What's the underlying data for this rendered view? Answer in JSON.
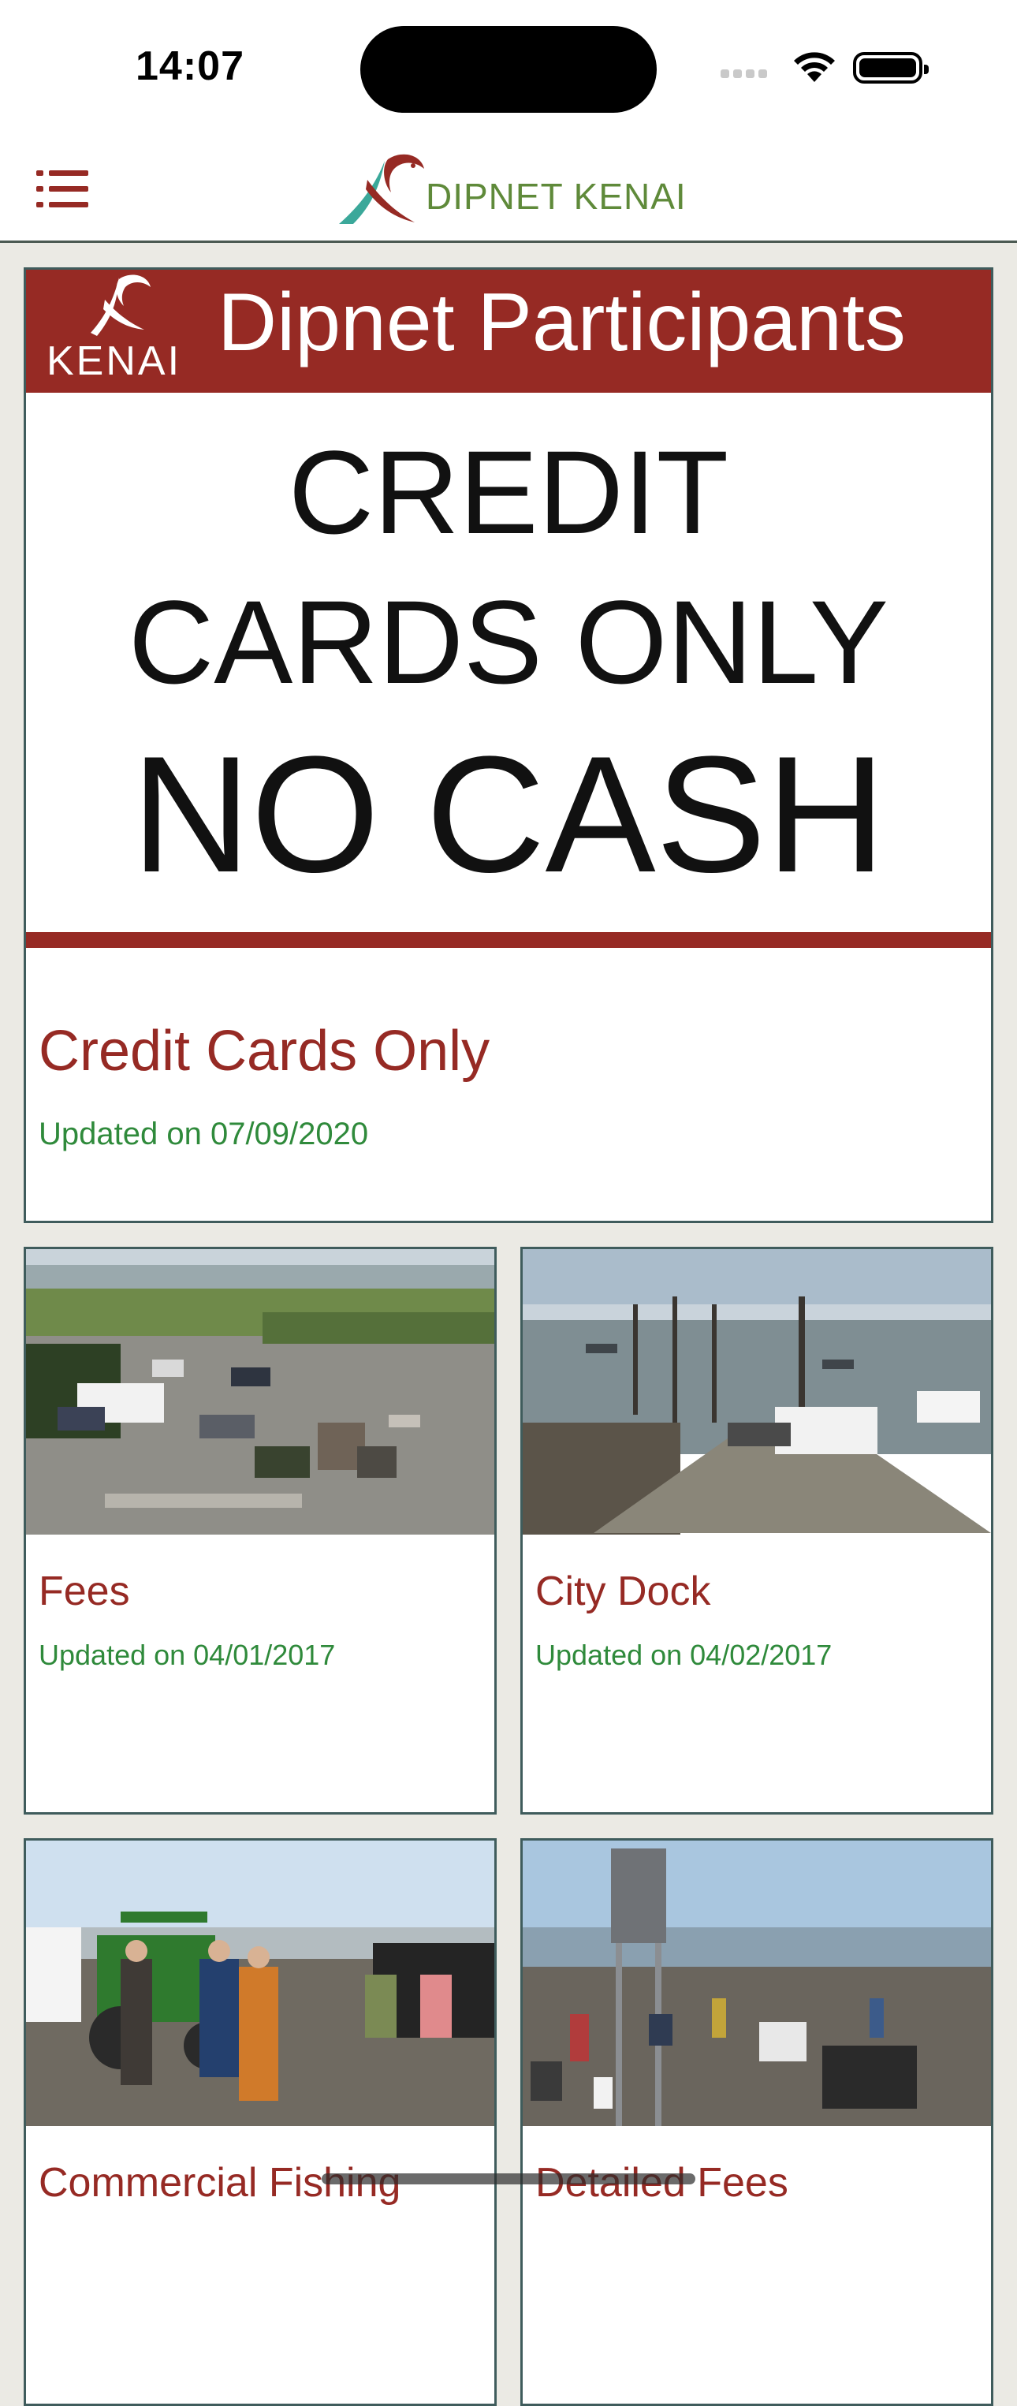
{
  "status_bar": {
    "time": "14:07"
  },
  "header": {
    "brand": "DIPNET KENAI",
    "menu_icon": "list-icon"
  },
  "featured": {
    "banner_logo_text": "KENAI",
    "banner_title": "Dipnet Participants",
    "sign_lines": [
      "CREDIT",
      "CARDS ONLY",
      "NO CASH"
    ],
    "title": "Credit Cards Only",
    "updated": "Updated on 07/09/2020"
  },
  "cards": [
    {
      "title": "Fees",
      "updated": "Updated on 04/01/2017"
    },
    {
      "title": "City Dock",
      "updated": "Updated on 04/02/2017"
    },
    {
      "title": "Commercial Fishing",
      "updated": ""
    },
    {
      "title": "Detailed Fees",
      "updated": ""
    }
  ],
  "colors": {
    "brand_red": "#962a24",
    "brand_green": "#5f8a3a",
    "date_green": "#2f8a3b",
    "card_border": "#3f5c5c",
    "background": "#ebeae4"
  }
}
